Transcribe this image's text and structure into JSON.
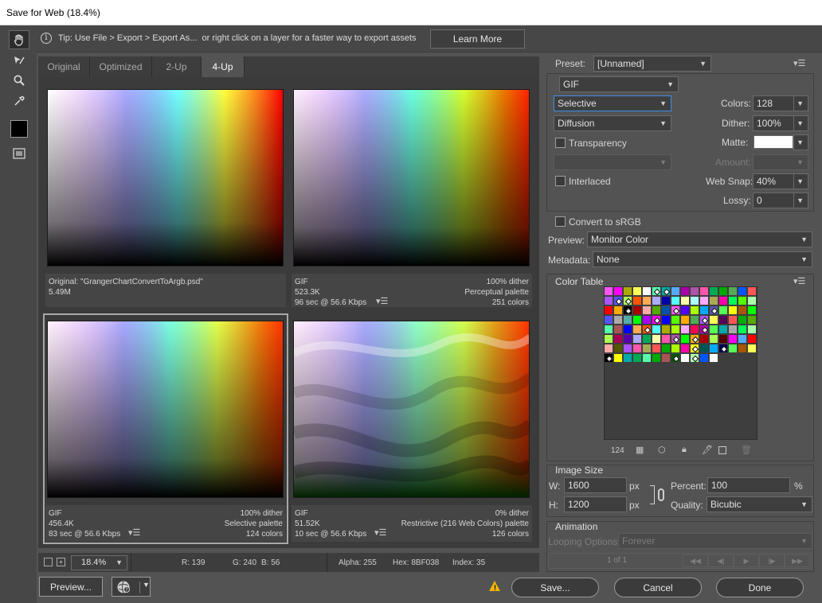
{
  "window": {
    "title": "Save for Web (18.4%)"
  },
  "tip": {
    "text": "Tip: Use File > Export > Export As...  or right click on a layer for a faster way to export assets",
    "learn_more": "Learn More"
  },
  "tabs": [
    "Original",
    "Optimized",
    "2-Up",
    "4-Up"
  ],
  "panes": [
    {
      "l1": "Original: \"GrangerChartConvertToArgb.psd\"",
      "l2": "5.49M",
      "l3": "",
      "r1": "",
      "r2": "",
      "r3": ""
    },
    {
      "l1": "GIF",
      "l2": "523.3K",
      "l3": "96 sec @ 56.6 Kbps",
      "r1": "100% dither",
      "r2": "Perceptual palette",
      "r3": "251 colors"
    },
    {
      "l1": "GIF",
      "l2": "456.4K",
      "l3": "83 sec @ 56.6 Kbps",
      "r1": "100% dither",
      "r2": "Selective palette",
      "r3": "124 colors"
    },
    {
      "l1": "GIF",
      "l2": "51.52K",
      "l3": "10 sec @ 56.6 Kbps",
      "r1": "0% dither",
      "r2": "Restrictive (216 Web Colors) palette",
      "r3": "126 colors"
    }
  ],
  "status": {
    "zoom": "18.4%",
    "r": "R: 139",
    "g": "G: 240",
    "b": "B: 56",
    "alpha": "Alpha: 255",
    "hex": "Hex: 8BF038",
    "index": "Index: 35"
  },
  "bottom": {
    "preview": "Preview...",
    "save": "Save...",
    "cancel": "Cancel",
    "done": "Done"
  },
  "settings": {
    "preset_label": "Preset:",
    "preset_value": "[Unnamed]",
    "format": "GIF",
    "reduction": "Selective",
    "dither_algo": "Diffusion",
    "colors_label": "Colors:",
    "colors_value": "128",
    "dither_label": "Dither:",
    "dither_value": "100%",
    "transparency": "Transparency",
    "matte_label": "Matte:",
    "amount_label": "Amount:",
    "interlaced": "Interlaced",
    "websnap_label": "Web Snap:",
    "websnap_value": "40%",
    "lossy_label": "Lossy:",
    "lossy_value": "0",
    "srgb": "Convert to sRGB",
    "preview_label": "Preview:",
    "preview_value": "Monitor Color",
    "metadata_label": "Metadata:",
    "metadata_value": "None"
  },
  "color_table": {
    "title": "Color Table",
    "count": "124",
    "colors": [
      "#ff55ff",
      "#ff00ff",
      "#aaaa00",
      "#ffff55",
      "#ffffff",
      "#55ffaa",
      "#00aaaa",
      "#55aaff",
      "#aa00aa",
      "#aa55aa",
      "#ff55aa",
      "#00aa55",
      "#00aa00",
      "#55aa55",
      "#0055ff",
      "#ff5555",
      "#aa55ff",
      "#5555ff",
      "#aaff55",
      "#ff5500",
      "#ffaa55",
      "#aaaaff",
      "#0000aa",
      "#55ffff",
      "#ffffaa",
      "#aaffff",
      "#ffaaff",
      "#aaaa55",
      "#ff00aa",
      "#00ff55",
      "#55ff00",
      "#aaffaa",
      "#ff0000",
      "#ffaa00",
      "#000000",
      "#aa0000",
      "#ffaaaa",
      "#55aa00",
      "#0055aa",
      "#ff55ff",
      "#5500ff",
      "#aaff00",
      "#00aaff",
      "#5555aa",
      "#55ff55",
      "#ffff00",
      "#aa5500",
      "#00ff00",
      "#5555ff",
      "#aaaaaa",
      "#55aaaa",
      "#00ff00",
      "#aa00ff",
      "#ff00ff",
      "#0000ff",
      "#55ff00",
      "#ffaa00",
      "#55aa55",
      "#aa55ff",
      "#ffff55",
      "#550055",
      "#ff5555",
      "#00aa00",
      "#55aa00",
      "#55ffaa",
      "#aa5555",
      "#0000ff",
      "#ffaa55",
      "#ff5500",
      "#55ffff",
      "#aaaa00",
      "#aaff00",
      "#ffaaff",
      "#ff0055",
      "#aa00aa",
      "#55ff55",
      "#00aaaa",
      "#aaaaaa",
      "#00ff55",
      "#aaffaa",
      "#aaff55",
      "#aa0055",
      "#5500aa",
      "#aaaaff",
      "#00aa55",
      "#ffffaa",
      "#ff55aa",
      "#aa55aa",
      "#00ff00",
      "#ffaa00",
      "#aa0000",
      "#aaff55",
      "#550000",
      "#ff00ff",
      "#55aaff",
      "#ff0000",
      "#ffaaaa",
      "#555500",
      "#aa55ff",
      "#ff55aa",
      "#aaaa55",
      "#ff5555",
      "#00aa00",
      "#aaff00",
      "#ff00aa",
      "#ffff00",
      "#005555",
      "#00aaff",
      "#000055",
      "#55ff55",
      "#aa5500",
      "#ffff55",
      "#000000",
      "#ffff00",
      "#00aaaa",
      "#00aa55",
      "#55ffaa",
      "#00aa00",
      "#aa5555",
      "#005500",
      "#ffffff",
      "#aaffaa",
      "#0055ff",
      "#ffffff"
    ],
    "locked": [
      5,
      6,
      17,
      18,
      34,
      39,
      43,
      53,
      58,
      68,
      74,
      87,
      89,
      105,
      108,
      112,
      119,
      121,
      124
    ]
  },
  "image_size": {
    "title": "Image Size",
    "w_label": "W:",
    "w_value": "1600",
    "h_label": "H:",
    "h_value": "1200",
    "unit": "px",
    "percent_label": "Percent:",
    "percent_value": "100",
    "percent_unit": "%",
    "quality_label": "Quality:",
    "quality_value": "Bicubic"
  },
  "animation": {
    "title": "Animation",
    "looping_label": "Looping Options:",
    "looping_value": "Forever",
    "frame": "1 of 1"
  }
}
